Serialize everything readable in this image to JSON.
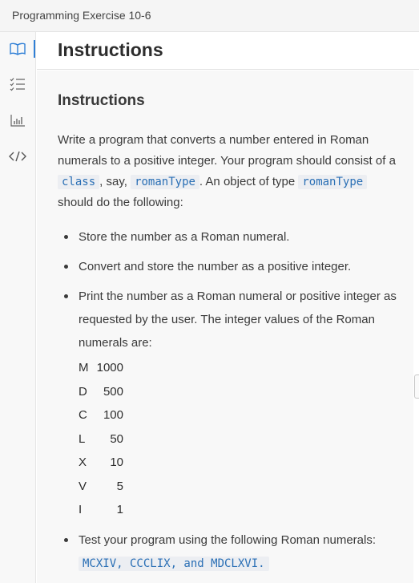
{
  "window": {
    "title": "Programming Exercise 10-6"
  },
  "sidebar": {
    "icons": [
      "book-icon",
      "checklist-icon",
      "chart-icon",
      "code-icon"
    ]
  },
  "header": {
    "title": "Instructions"
  },
  "content": {
    "section_title": "Instructions",
    "intro": {
      "t1": "Write a program that converts a number entered in Roman numerals to a positive integer. Your program should consist of a ",
      "code1": "class",
      "t2": ", say, ",
      "code2": "romanType",
      "t3": ". An object of type ",
      "code3": "romanType",
      "t4": " should do the following:"
    },
    "bullets": {
      "b1": "Store the number as a Roman numeral.",
      "b2": "Convert and store the number as a positive integer.",
      "b3": "Print the number as a Roman numeral or positive integer as requested by the user. The integer values of the Roman numerals are:",
      "b4_text": "Test your program using the following Roman numerals: ",
      "b4_code": "MCXIV, CCCLIX, and MDCLXVI."
    },
    "numerals": [
      {
        "sym": "M",
        "val": "1000"
      },
      {
        "sym": "D",
        "val": "500"
      },
      {
        "sym": "C",
        "val": "100"
      },
      {
        "sym": "L",
        "val": "50"
      },
      {
        "sym": "X",
        "val": "10"
      },
      {
        "sym": "V",
        "val": "5"
      },
      {
        "sym": "I",
        "val": "1"
      }
    ]
  }
}
